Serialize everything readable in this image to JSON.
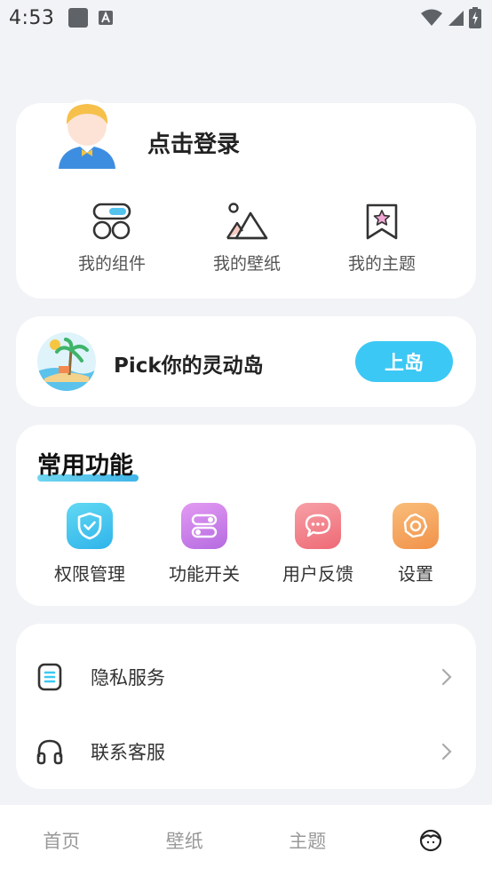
{
  "status_bar": {
    "time": "4:53"
  },
  "profile": {
    "login_text": "点击登录",
    "quick_links": [
      {
        "label": "我的组件",
        "icon": "widgets-icon"
      },
      {
        "label": "我的壁纸",
        "icon": "wallpaper-icon"
      },
      {
        "label": "我的主题",
        "icon": "theme-bookmark-icon"
      }
    ]
  },
  "island": {
    "text": "Pick你的灵动岛",
    "button_label": "上岛",
    "button_color": "#3cc8f4"
  },
  "functions": {
    "title": "常用功能",
    "items": [
      {
        "label": "权限管理",
        "icon": "shield-check-icon",
        "color": "#40c8ef"
      },
      {
        "label": "功能开关",
        "icon": "toggle-switch-icon",
        "color": "#c77fe8"
      },
      {
        "label": "用户反馈",
        "icon": "chat-bubble-icon",
        "color": "#f27b83"
      },
      {
        "label": "设置",
        "icon": "settings-gear-icon",
        "color": "#f5a05a"
      }
    ]
  },
  "list": {
    "items": [
      {
        "label": "隐私服务",
        "icon": "document-icon"
      },
      {
        "label": "联系客服",
        "icon": "headphones-icon"
      }
    ]
  },
  "bottom_nav": {
    "items": [
      {
        "label": "首页"
      },
      {
        "label": "壁纸"
      },
      {
        "label": "主题"
      },
      {
        "label": "",
        "icon": "profile-face-icon"
      }
    ]
  }
}
